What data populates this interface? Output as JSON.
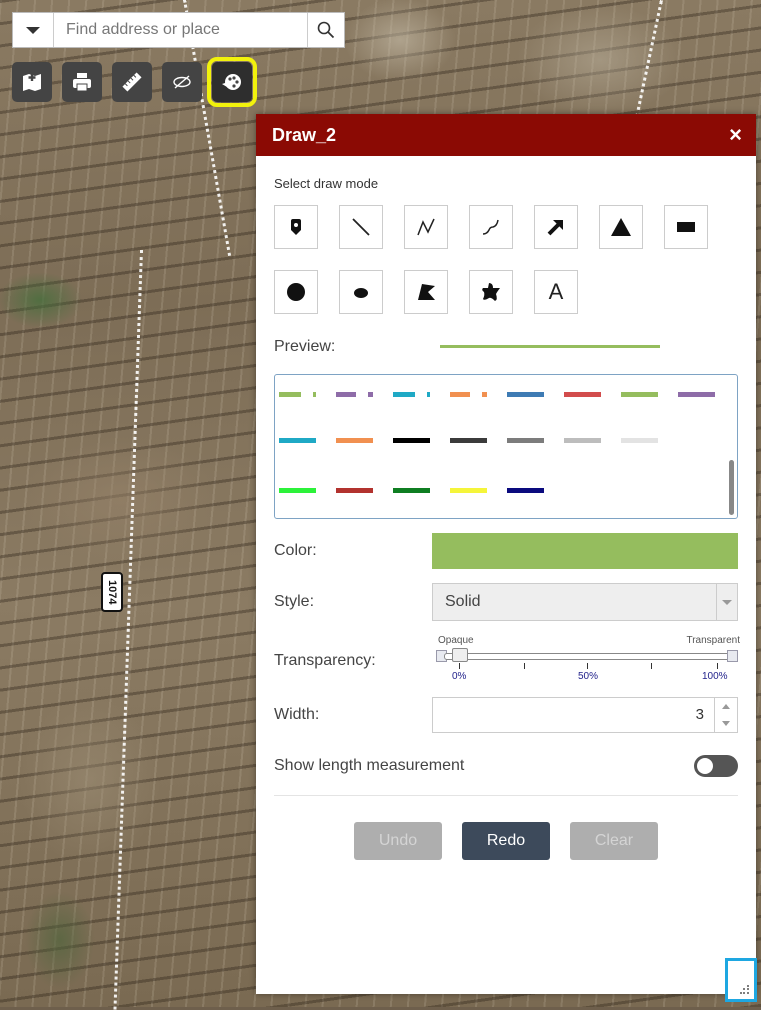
{
  "search": {
    "placeholder": "Find address or place"
  },
  "toolbar": {
    "tools": [
      {
        "icon": "add-data-icon"
      },
      {
        "icon": "print-icon"
      },
      {
        "icon": "measure-icon"
      },
      {
        "icon": "visibility-icon"
      },
      {
        "icon": "draw-palette-icon",
        "active": true
      }
    ]
  },
  "panel": {
    "title": "Draw_2",
    "close": "×",
    "select_mode_label": "Select draw mode",
    "modes": [
      "point-icon",
      "line-icon",
      "polyline-icon",
      "freehand-polyline-icon",
      "arrow-icon",
      "triangle-icon",
      "rectangle-icon",
      "circle-icon",
      "ellipse-icon",
      "polygon-icon",
      "freehand-polygon-icon",
      "text-icon"
    ],
    "text_mode_glyph": "A",
    "preview_label": "Preview:",
    "preview_color": "#95bd5e",
    "swatch_rows": [
      [
        {
          "color": "#95bd5e",
          "dash": "d1"
        },
        {
          "color": "#8e6ca8",
          "dash": "d2"
        },
        {
          "color": "#1fa9c5",
          "dash": "d1"
        },
        {
          "color": "#f19050",
          "dash": "d2"
        },
        {
          "color": "#3e7bb4"
        },
        {
          "color": "#d24c4c"
        },
        {
          "color": "#95bd5e"
        },
        {
          "color": "#8e6ca8"
        }
      ],
      [
        {
          "color": "#1fa9c5"
        },
        {
          "color": "#f19050"
        },
        {
          "color": "#000000"
        },
        {
          "color": "#3b3b3b"
        },
        {
          "color": "#7c7c7c"
        },
        {
          "color": "#bdbdbd"
        },
        {
          "color": "#e3e3e3"
        }
      ],
      [
        {
          "color": "#2cf23a"
        },
        {
          "color": "#b2322e"
        },
        {
          "color": "#0f7e22"
        },
        {
          "color": "#f5f53a"
        },
        {
          "color": "#0a0a7e"
        }
      ]
    ],
    "color_label": "Color:",
    "color_value": "#95bd5e",
    "style_label": "Style:",
    "style_value": "Solid",
    "transparency_label": "Transparency:",
    "transparency": {
      "min_label": "Opaque",
      "max_label": "Transparent",
      "ticks": [
        "0%",
        "50%",
        "100%"
      ],
      "value": 0
    },
    "width_label": "Width:",
    "width_value": "3",
    "measure_label": "Show length measurement",
    "measure_on": false,
    "buttons": {
      "undo": "Undo",
      "redo": "Redo",
      "clear": "Clear"
    }
  },
  "map": {
    "road_label": "1074"
  }
}
